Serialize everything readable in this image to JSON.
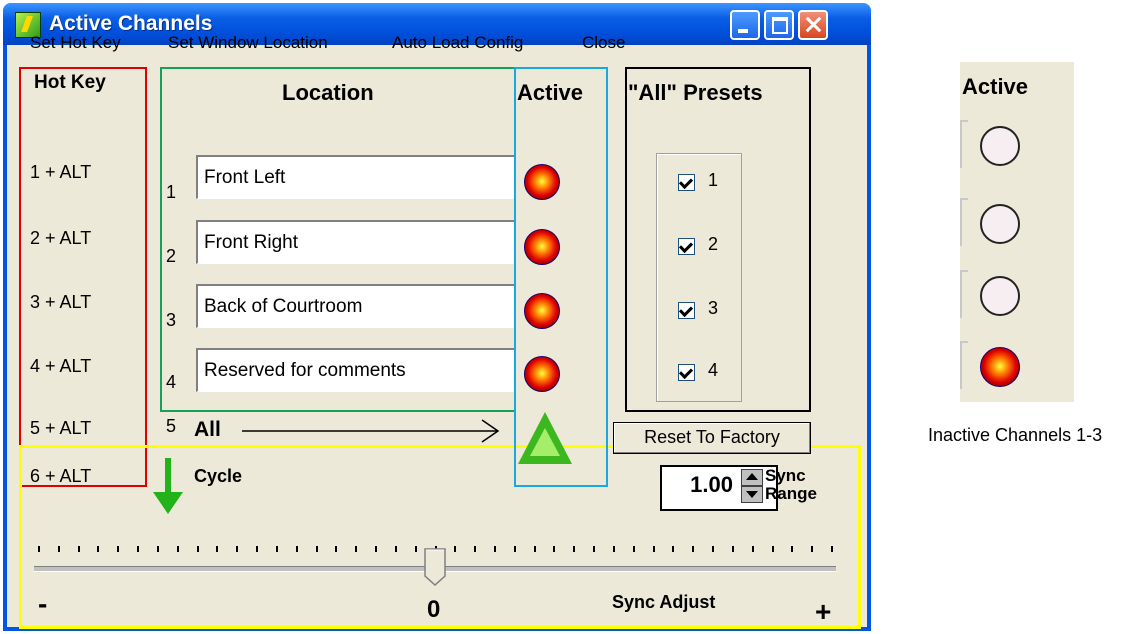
{
  "window": {
    "title": "Active Channels"
  },
  "menu": [
    "Set Hot Key",
    "Set Window Location",
    "Auto Load Config",
    "Close"
  ],
  "headers": {
    "hotkey": "Hot Key",
    "location": "Location",
    "active": "Active",
    "presets": "\"All\" Presets"
  },
  "channels": [
    {
      "num": "1",
      "hotkey": "1 + ALT",
      "location": "Front Left",
      "preset_checked": true
    },
    {
      "num": "2",
      "hotkey": "2 + ALT",
      "location": "Front Right",
      "preset_checked": true
    },
    {
      "num": "3",
      "hotkey": "3 + ALT",
      "location": "Back of Courtroom",
      "preset_checked": true
    },
    {
      "num": "4",
      "hotkey": "4 + ALT",
      "location": "Reserved for comments",
      "preset_checked": true
    }
  ],
  "all_row": {
    "hotkey": "5 + ALT",
    "num": "5",
    "label": "All"
  },
  "cycle_row": {
    "hotkey": "6 + ALT",
    "label": "Cycle"
  },
  "reset_button": "Reset To Factory",
  "sync_range": {
    "value": "1.00",
    "label_line1": "Sync",
    "label_line2": "Range"
  },
  "sync_adjust": {
    "label": "Sync Adjust",
    "min_label": "-",
    "max_label": "+",
    "value_label": "0",
    "value": 0
  },
  "side_image": {
    "header": "Active",
    "caption": "Inactive Channels 1-3"
  },
  "colors": {
    "hotkey_frame": "#e00000",
    "location_frame": "#16a05a",
    "active_frame": "#1aa8e0",
    "presets_frame": "#000000",
    "sync_frame": "#ffff00"
  },
  "icons": [
    "app-icon",
    "minimize-icon",
    "maximize-icon",
    "close-icon",
    "active-indicator-icon",
    "cycle-up-triangle-icon",
    "cycle-down-arrow-icon"
  ]
}
